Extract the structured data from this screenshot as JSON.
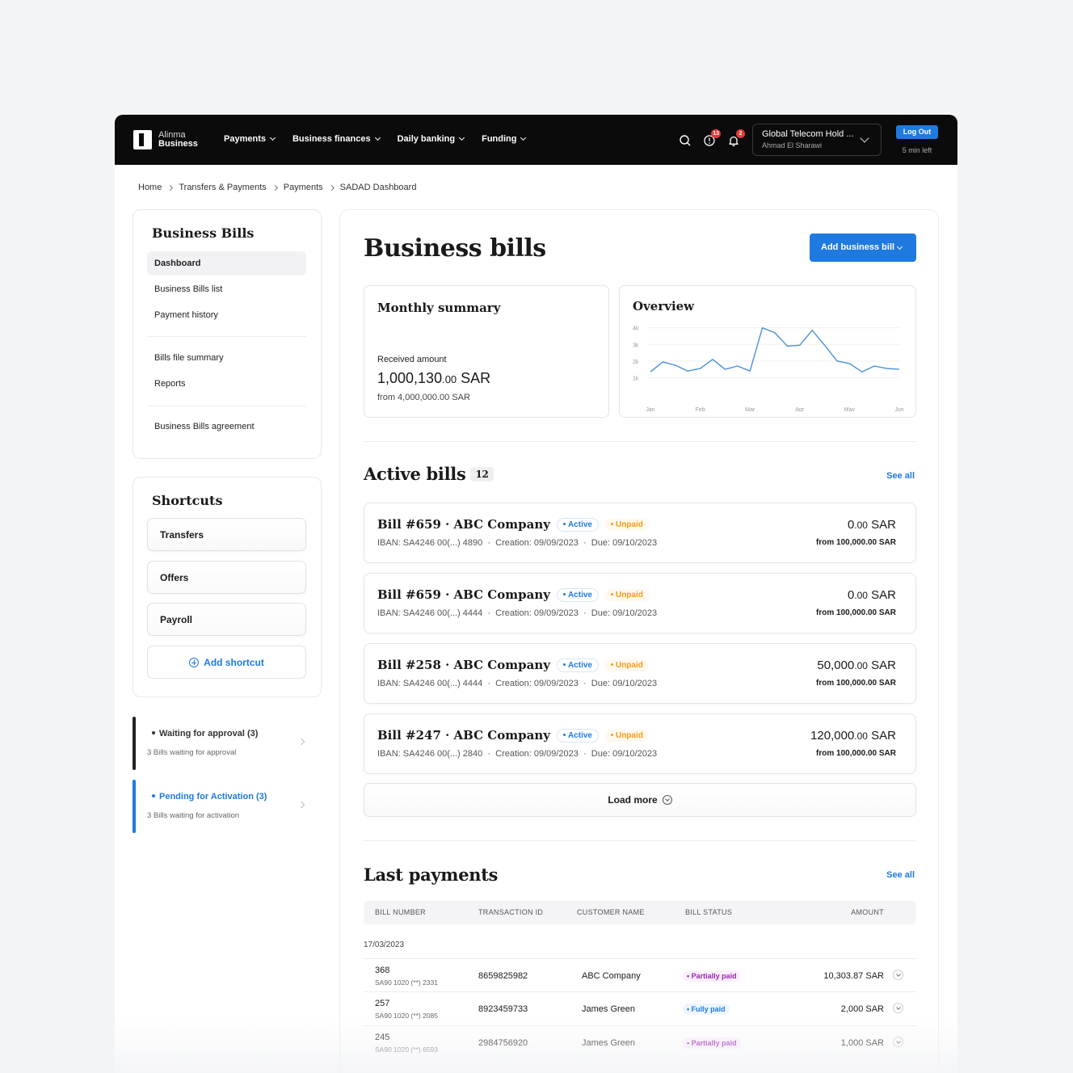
{
  "app": {
    "brand_line1": "Alinma",
    "brand_line2": "Business"
  },
  "nav": {
    "items": [
      {
        "label": "Payments"
      },
      {
        "label": "Business finances"
      },
      {
        "label": "Daily banking"
      },
      {
        "label": "Funding"
      }
    ]
  },
  "header": {
    "icons": [
      "search-icon",
      "alert-icon",
      "bell-icon"
    ],
    "alerts_count": "13",
    "notifications_count": "2",
    "account_name": "Global Telecom Hold ...",
    "account_user": "Ahmad El Sharawi",
    "logout_label": "Log Out",
    "session_left": "5 min left"
  },
  "breadcrumb": [
    "Home",
    "Transfers & Payments",
    "Payments",
    "SADAD Dashboard"
  ],
  "sidebar": {
    "title": "Business Bills",
    "items": [
      {
        "label": "Dashboard"
      },
      {
        "label": "Business Bills list"
      },
      {
        "label": "Payment history"
      },
      {
        "label": "Bills file summary"
      },
      {
        "label": "Reports"
      },
      {
        "label": "Business Bills agreement"
      }
    ],
    "shortcuts_title": "Shortcuts",
    "shortcuts": [
      {
        "label": "Transfers"
      },
      {
        "label": "Offers"
      },
      {
        "label": "Payroll"
      }
    ],
    "add_shortcut": "Add shortcut",
    "status_cards": [
      {
        "title": "Waiting for approval (3)",
        "subtitle": "3 Bills waiting for approval",
        "color": "#222222"
      },
      {
        "title": "Pending for Activation (3)",
        "subtitle": "3 Bills waiting for activation",
        "color": "#1f7ae0"
      }
    ]
  },
  "main": {
    "title": "Business bills",
    "add_button": "Add business bill",
    "summary": {
      "title": "Monthly summary",
      "label": "Received amount",
      "amount_int": "1,000,130",
      "amount_dec": ".00",
      "currency": "SAR",
      "from": "from 4,000,000.00 SAR"
    },
    "overview_title": "Overview",
    "active_title": "Active bills",
    "active_count": "12",
    "see_all": "See all",
    "bills": [
      {
        "title": "Bill #659 · ABC Company",
        "status": "Active",
        "payment": "Unpaid",
        "iban": "IBAN: SA4246 00(...) 4890",
        "creation": "Creation: 09/09/2023",
        "due": "Due: 09/10/2023",
        "amount_int": "0",
        "amount_dec": ".00",
        "currency": "SAR",
        "from": "from 100,000.00 SAR"
      },
      {
        "title": "Bill #659 · ABC Company",
        "status": "Active",
        "payment": "Unpaid",
        "iban": "IBAN: SA4246 00(...) 4444",
        "creation": "Creation: 09/09/2023",
        "due": "Due: 09/10/2023",
        "amount_int": "0",
        "amount_dec": ".00",
        "currency": "SAR",
        "from": "from 100,000.00 SAR"
      },
      {
        "title": "Bill #258 · ABC Company",
        "status": "Active",
        "payment": "Unpaid",
        "iban": "IBAN: SA4246 00(...) 4444",
        "creation": "Creation: 09/09/2023",
        "due": "Due: 09/10/2023",
        "amount_int": "50,000",
        "amount_dec": ".00",
        "currency": "SAR",
        "from": "from 100,000.00 SAR"
      },
      {
        "title": "Bill #247 · ABC Company",
        "status": "Active",
        "payment": "Unpaid",
        "iban": "IBAN: SA4246 00(...) 2840",
        "creation": "Creation: 09/09/2023",
        "due": "Due: 09/10/2023",
        "amount_int": "120,000",
        "amount_dec": ".00",
        "currency": "SAR",
        "from": "from 100,000.00 SAR"
      }
    ],
    "load_more": "Load more",
    "payments_title": "Last payments",
    "table_headers": [
      "BILL NUMBER",
      "TRANSACTION ID",
      "CUSTOMER NAME",
      "BILL STATUS",
      "AMOUNT"
    ],
    "date_group": "17/03/2023",
    "rows": [
      {
        "bill": "368",
        "iban": "SA90 1020 (**) 2331",
        "tx": "8659825982",
        "customer": "ABC Company",
        "status": "Partially paid",
        "amount": "10,303.87 SAR"
      },
      {
        "bill": "257",
        "iban": "SA90 1020 (**) 2085",
        "tx": "8923459733",
        "customer": "James Green",
        "status": "Fully paid",
        "amount": "2,000 SAR"
      },
      {
        "bill": "245",
        "iban": "SA90 1020 (**) 6593",
        "tx": "2984756920",
        "customer": "James Green",
        "status": "Partially paid",
        "amount": "1,000 SAR"
      }
    ]
  },
  "chart_data": {
    "type": "line",
    "title": "Overview",
    "x_labels": [
      "Jan",
      "Feb",
      "Mar",
      "Apr",
      "May",
      "Jun"
    ],
    "y_ticks": [
      "4k",
      "3k",
      "2k",
      "1k"
    ],
    "ylim": [
      0,
      4000
    ],
    "x": [
      0,
      0.25,
      0.5,
      0.75,
      1,
      1.25,
      1.5,
      1.75,
      2,
      2.25,
      2.5,
      2.75,
      3,
      3.25,
      3.5,
      3.75,
      4,
      4.25,
      4.5,
      4.75,
      5
    ],
    "values": [
      1350,
      1950,
      1750,
      1400,
      1550,
      2100,
      1500,
      1700,
      1400,
      4000,
      3700,
      2900,
      2950,
      3850,
      2950,
      2000,
      1850,
      1350,
      1700,
      1550,
      1500
    ],
    "color": "#4a90d9",
    "grid": true
  }
}
